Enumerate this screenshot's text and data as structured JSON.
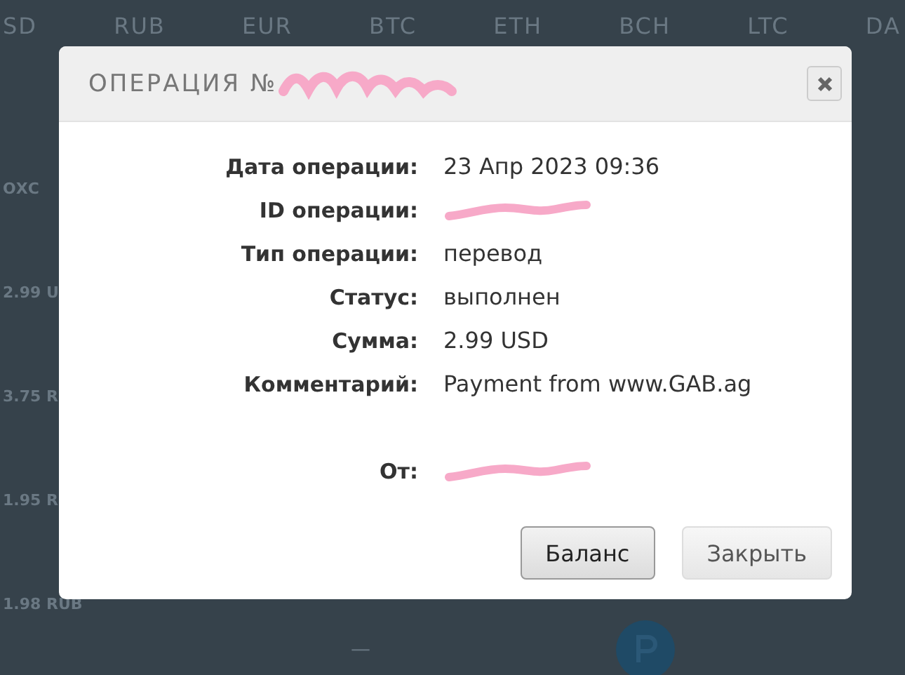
{
  "background": {
    "columns": [
      "SD",
      "RUB",
      "EUR",
      "BTC",
      "ETH",
      "BCH",
      "LTC",
      "DA"
    ],
    "left_column": [
      "ОХС",
      "2.99 U",
      "3.75 R",
      "1.95 R",
      "1.98 RUB"
    ],
    "dash": "—"
  },
  "dialog": {
    "title": "ОПЕРАЦИЯ №",
    "title_redacted": true,
    "fields": [
      {
        "label": "Дата операции:",
        "value": "23 Апр 2023 09:36"
      },
      {
        "label": "ID операции:",
        "redacted": true
      },
      {
        "label": "Тип операции:",
        "value": "перевод"
      },
      {
        "label": "Статус:",
        "value": "выполнен"
      },
      {
        "label": "Сумма:",
        "value": "2.99 USD"
      },
      {
        "label": "Комментарий:",
        "value": "Payment from www.GAB.ag"
      },
      {
        "label": "От:",
        "redacted": true,
        "gap": true
      }
    ],
    "buttons": [
      {
        "label": "Баланс",
        "selected": true
      },
      {
        "label": "Закрыть",
        "selected": false
      }
    ]
  }
}
